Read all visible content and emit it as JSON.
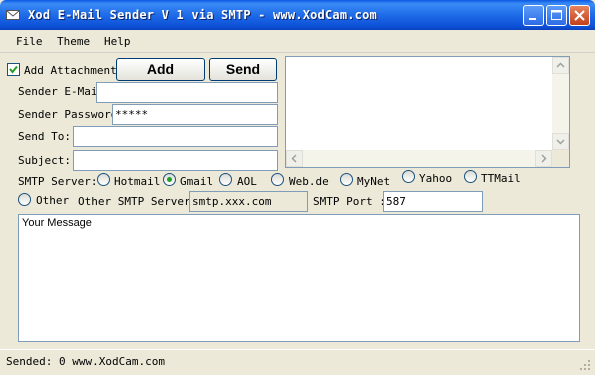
{
  "window": {
    "title": "Xod E-Mail Sender V 1 via SMTP - www.XodCam.com",
    "controls": [
      "minimize-icon",
      "maximize-icon",
      "close-icon"
    ]
  },
  "menu": {
    "file": "File",
    "theme": "Theme",
    "help": "Help"
  },
  "attachment": {
    "label": "Add Attachment",
    "checked": true
  },
  "buttons": {
    "add": "Add",
    "send": "Send"
  },
  "form": {
    "sender_email_label": "Sender E-Mail",
    "sender_email_value": "",
    "sender_password_label": "Sender Password:",
    "sender_password_value": "*****",
    "send_to_label": "Send To:",
    "send_to_value": "",
    "subject_label": "Subject:",
    "subject_value": ""
  },
  "smtp": {
    "server_label": "SMTP Server:",
    "options": [
      "Hotmail",
      "Gmail",
      "AOL",
      "Web.de",
      "MyNet",
      "Yahoo",
      "TTMail"
    ],
    "selected": "Gmail",
    "other_label": "Other",
    "other_server_label": "Other SMTP Server",
    "other_server_value": "smtp.xxx.com",
    "port_label": "SMTP Port :",
    "port_value": "587"
  },
  "message": {
    "text": "Your Message"
  },
  "status": {
    "text": "Sended: 0 www.XodCam.com"
  },
  "colors": {
    "titlebar": "#0c4fd6",
    "face": "#ece9d8",
    "selected_radio": "#21a121"
  }
}
